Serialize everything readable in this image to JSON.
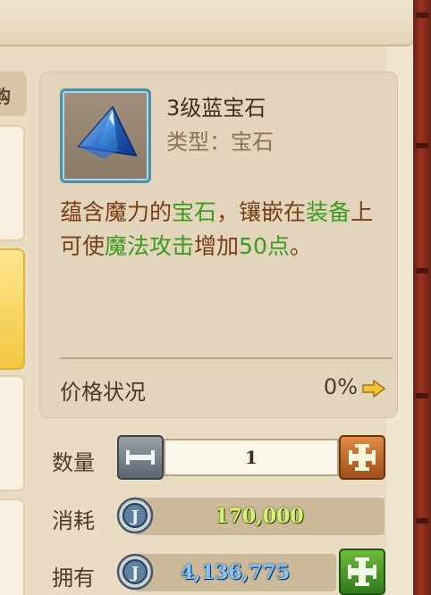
{
  "header": {
    "tab_label_partial": "购"
  },
  "item": {
    "name": "3级蓝宝石",
    "type_label": "类型：宝石",
    "description": [
      {
        "text": "蕴含魔力的",
        "hl": false
      },
      {
        "text": "宝石",
        "hl": true
      },
      {
        "text": "，镶嵌在",
        "hl": false
      },
      {
        "text": "装备",
        "hl": true
      },
      {
        "text": "上可使",
        "hl": false
      },
      {
        "text": "魔法攻击",
        "hl": true
      },
      {
        "text": "增加",
        "hl": false
      },
      {
        "text": "50点",
        "hl": true
      },
      {
        "text": "。",
        "hl": false
      }
    ]
  },
  "price_status": {
    "label": "价格状况",
    "value": "0%"
  },
  "quantity": {
    "label": "数量",
    "value": "1"
  },
  "cost": {
    "label": "消耗",
    "value": "170,000"
  },
  "owned": {
    "label": "拥有",
    "value": "4,136,775"
  },
  "colors": {
    "highlight_green": "#3e9a1e",
    "desc_brown": "#7b3d13",
    "cost_yellow": "#d7f56a",
    "owned_blue": "#7fc4ff"
  }
}
